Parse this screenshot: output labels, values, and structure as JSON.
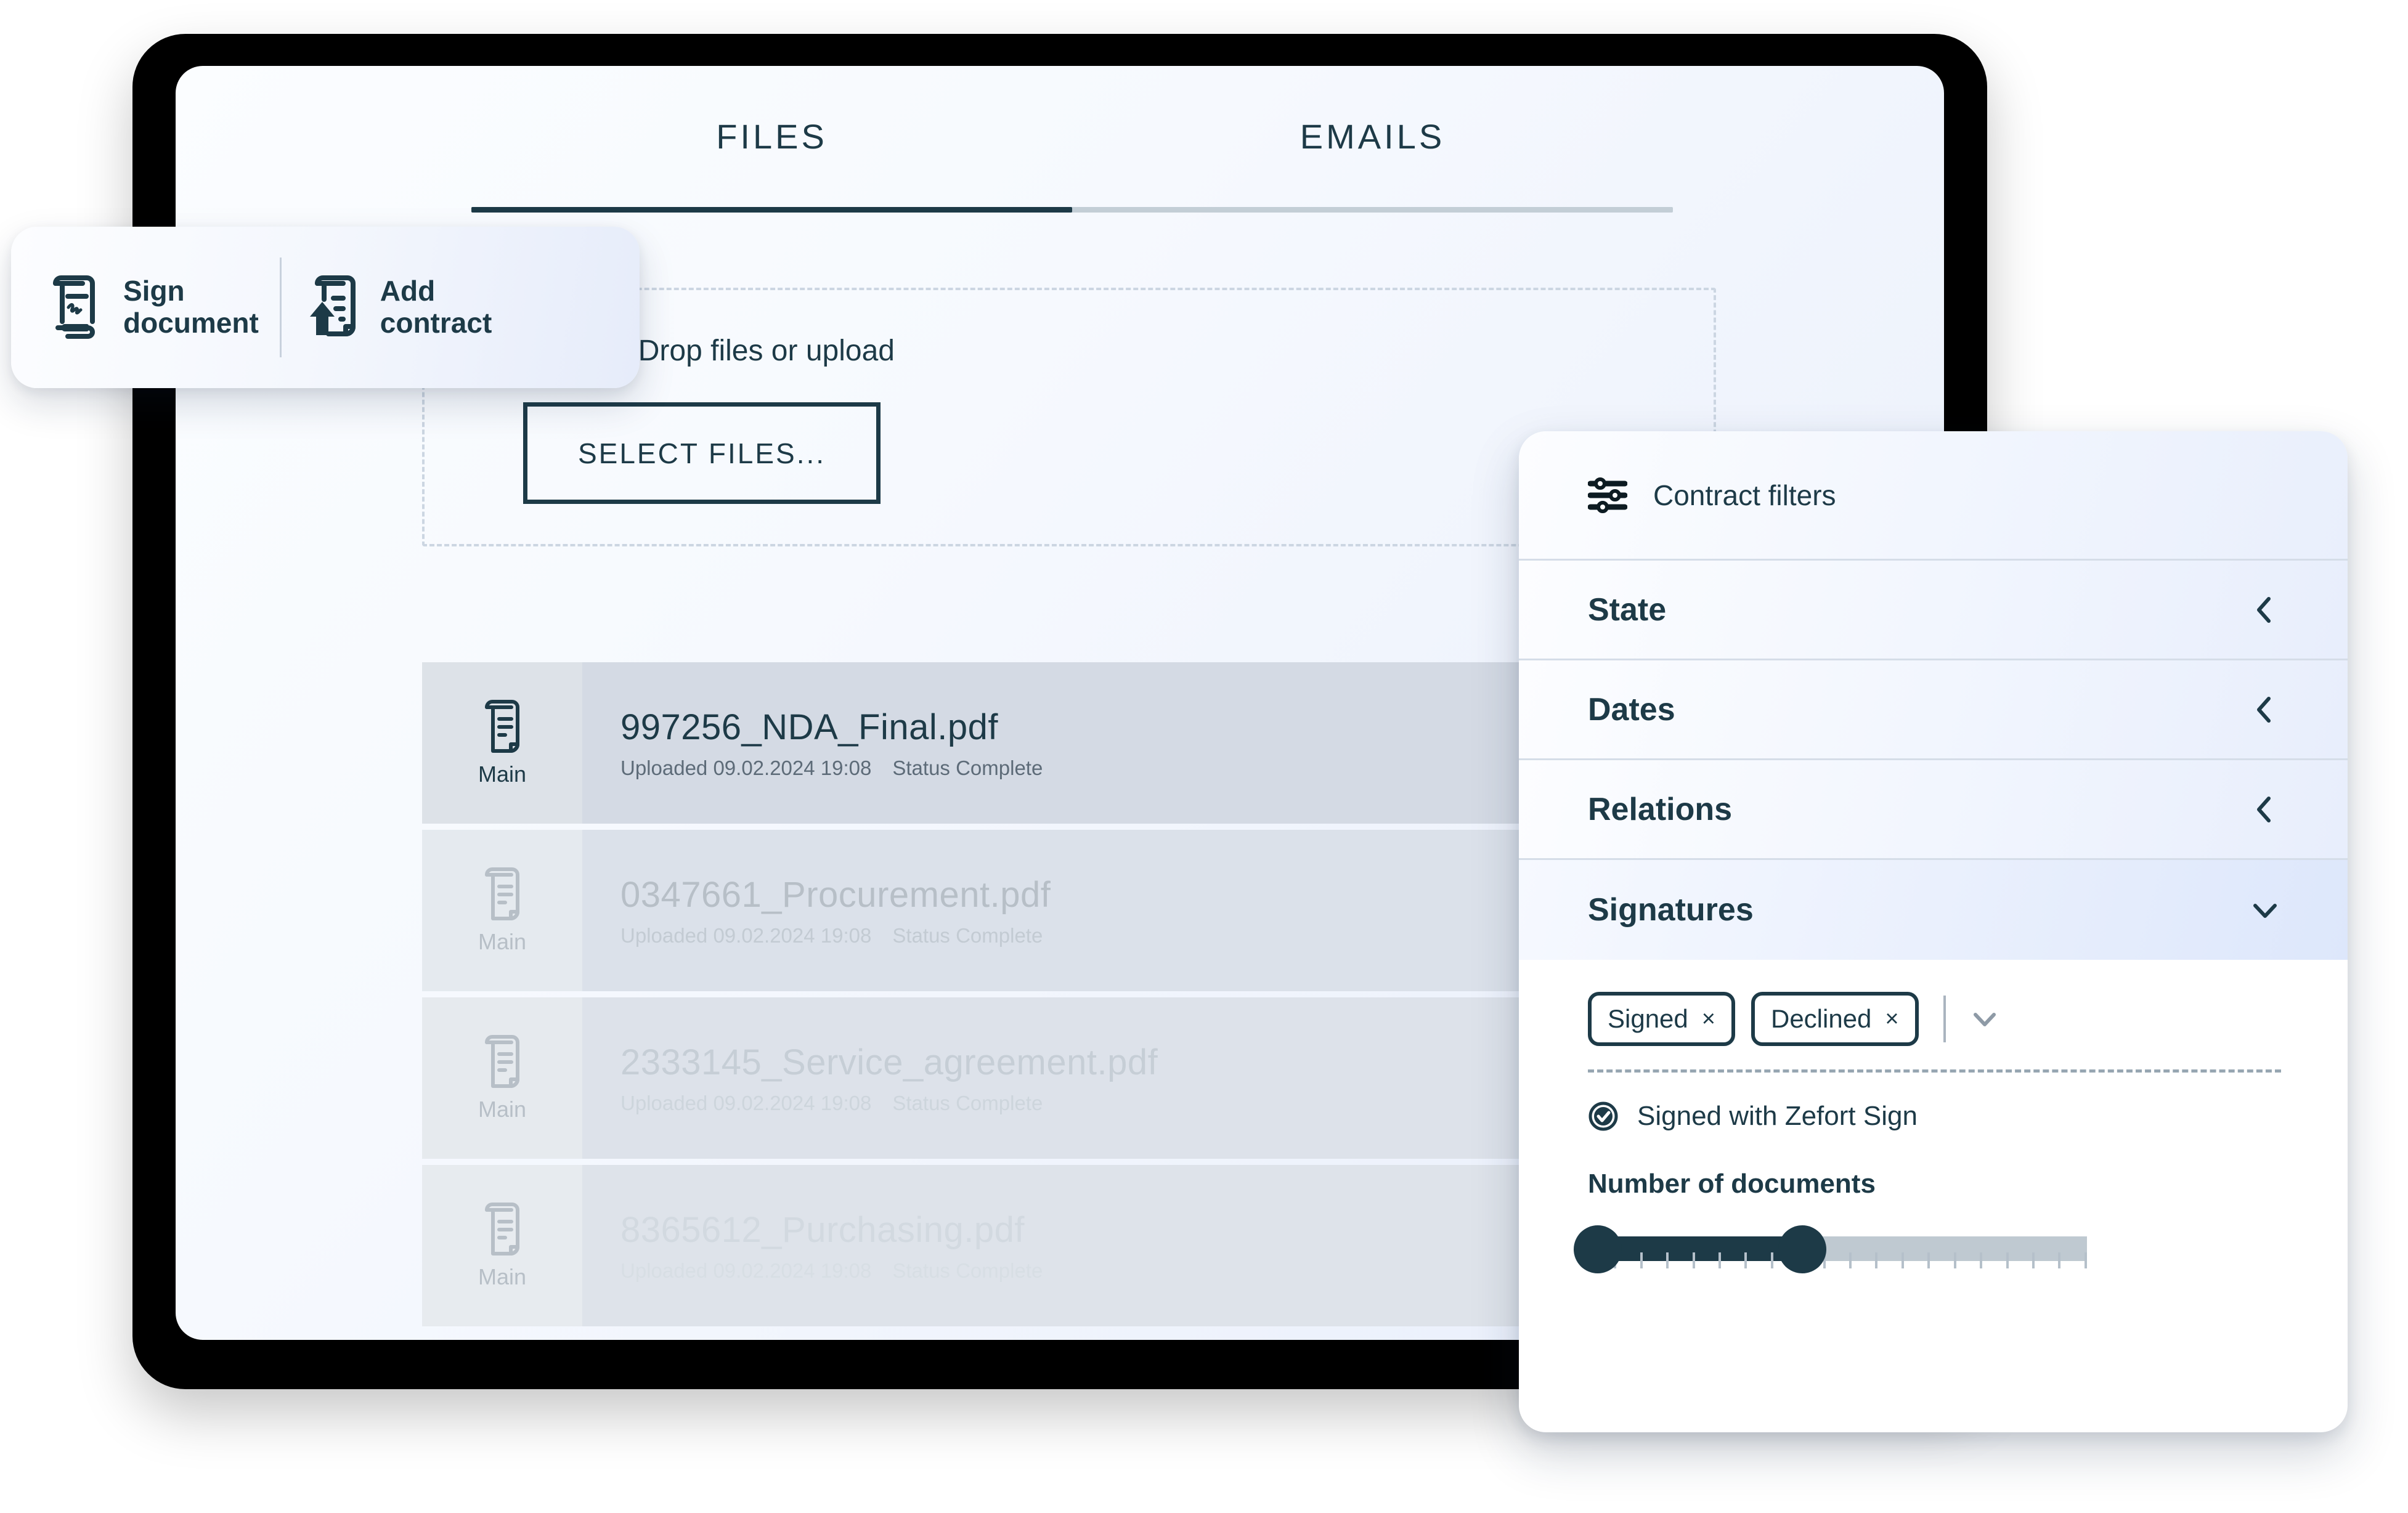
{
  "tabs": {
    "items": [
      {
        "label": "FILES",
        "active": true
      },
      {
        "label": "EMAILS",
        "active": false
      }
    ]
  },
  "dropzone": {
    "icon": "paperclip-icon",
    "text": "Drag & Drop files or upload",
    "button_label": "SELECT FILES..."
  },
  "actions": {
    "items": [
      {
        "icon": "sign-document-icon",
        "label": "Sign\ndocument"
      },
      {
        "icon": "add-contract-icon",
        "label": "Add\ncontract"
      }
    ]
  },
  "files": {
    "badge_label": "Main",
    "rows": [
      {
        "name": "997256_NDA_Final.pdf",
        "uploaded_label": "Uploaded 09.02.2024 19:08",
        "status_label": "Status Complete",
        "selected": true
      },
      {
        "name": "0347661_Procurement.pdf",
        "uploaded_label": "Uploaded 09.02.2024 19:08",
        "status_label": "Status Complete",
        "selected": false
      },
      {
        "name": "2333145_Service_agreement.pdf",
        "uploaded_label": "Uploaded 09.02.2024 19:08",
        "status_label": "Status Complete",
        "selected": false
      },
      {
        "name": "8365612_Purchasing.pdf",
        "uploaded_label": "Uploaded 09.02.2024 19:08",
        "status_label": "Status Complete",
        "selected": false
      }
    ]
  },
  "filters": {
    "title": "Contract filters",
    "title_icon": "sliders-icon",
    "sections": [
      {
        "label": "State",
        "expanded": false,
        "chevron": "chevron-left-icon"
      },
      {
        "label": "Dates",
        "expanded": false,
        "chevron": "chevron-left-icon"
      },
      {
        "label": "Relations",
        "expanded": false,
        "chevron": "chevron-left-icon"
      },
      {
        "label": "Signatures",
        "expanded": true,
        "chevron": "chevron-down-icon"
      }
    ],
    "signatures": {
      "chips": [
        {
          "label": "Signed",
          "remove": "×"
        },
        {
          "label": "Declined",
          "remove": "×"
        }
      ],
      "dropdown_icon": "chevron-down-icon",
      "checkbox": {
        "label": "Signed with Zefort Sign",
        "checked": true,
        "icon": "check-circle-icon"
      },
      "slider": {
        "label": "Number of documents",
        "start_percent": 0,
        "end_percent": 43,
        "tick_count": 20
      }
    }
  },
  "colors": {
    "ink": "#1d3a47",
    "muted": "#5d6b78",
    "faded": "#b7bfc7",
    "row_selected_bg": "#d4dae4",
    "row_bg": "#dde2ea",
    "badge_bg": "#dde2e8",
    "track": "#bfc9d1",
    "dashed": "#ccd6e2",
    "panel_bg": "#ffffff",
    "screen_gradient_start": "#fbfdff",
    "screen_gradient_end": "#e8eefb"
  }
}
